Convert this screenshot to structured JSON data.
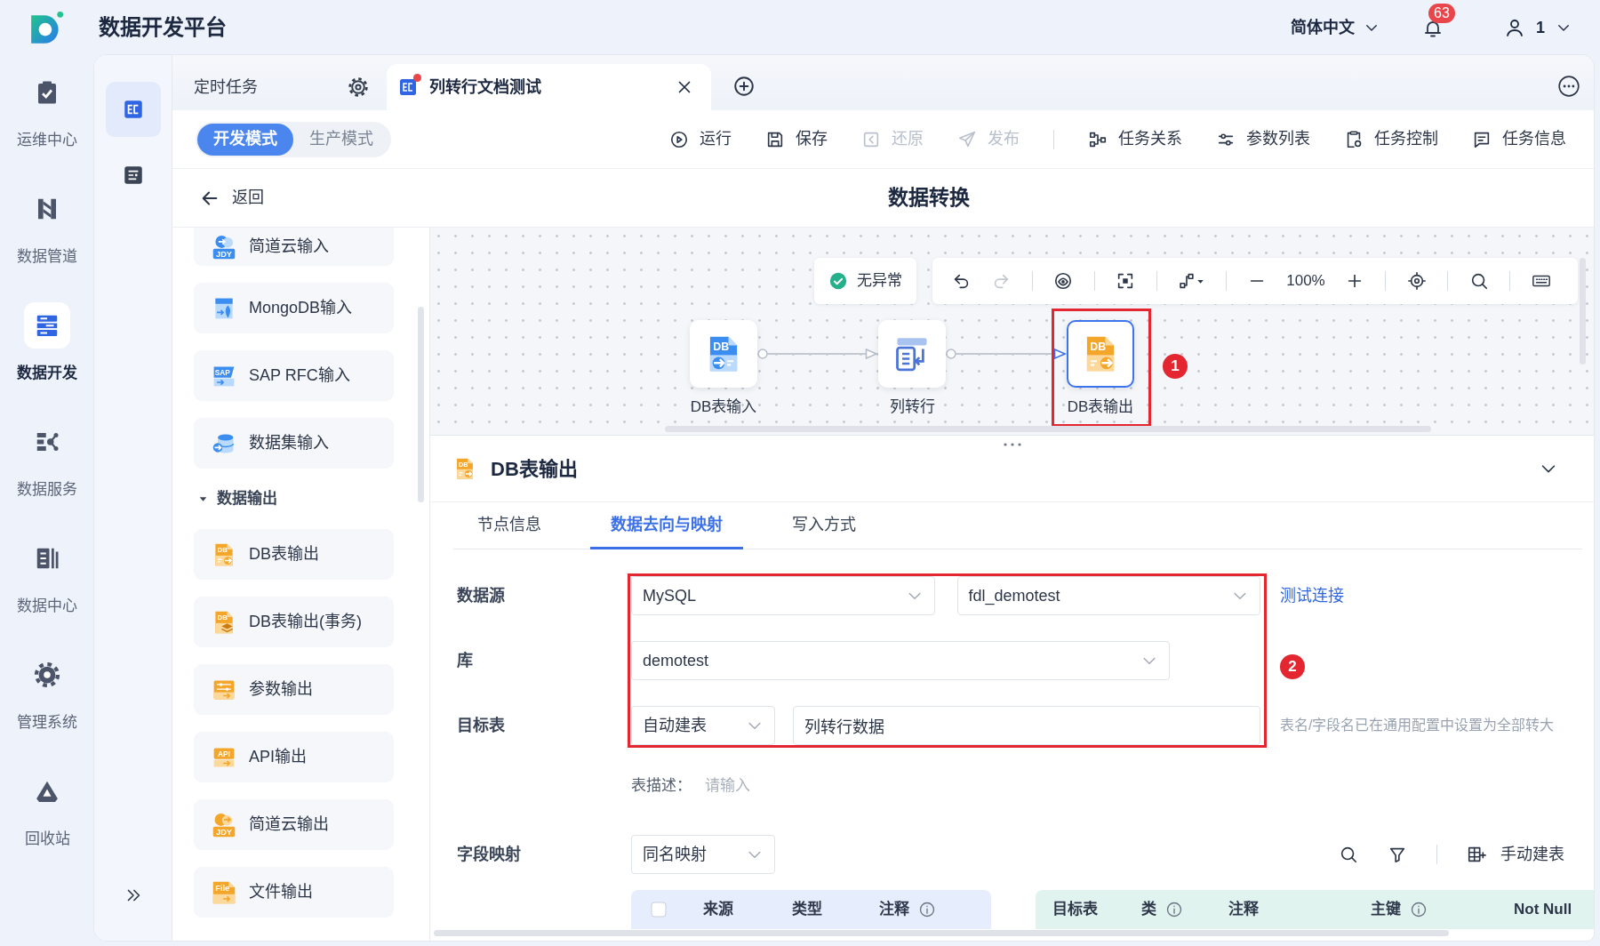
{
  "app": {
    "title": "数据开发平台",
    "language": "简体中文",
    "notifications": "63",
    "user": "1"
  },
  "nav": [
    {
      "label": "运维中心",
      "kind": "ops",
      "selected": false
    },
    {
      "label": "数据管道",
      "kind": "pipeline",
      "selected": false
    },
    {
      "label": "数据开发",
      "kind": "develop",
      "selected": true
    },
    {
      "label": "数据服务",
      "kind": "service",
      "selected": false
    },
    {
      "label": "数据中心",
      "kind": "center",
      "selected": false
    },
    {
      "label": "管理系统",
      "kind": "admin",
      "selected": false
    },
    {
      "label": "回收站",
      "kind": "recycle",
      "selected": false
    }
  ],
  "rail": [
    {
      "kind": "flow",
      "selected": true
    },
    {
      "kind": "list",
      "selected": false
    }
  ],
  "tabs": [
    {
      "label": "定时任务",
      "kind": "folder",
      "selected": false,
      "unsaved": false
    },
    {
      "label": "列转行文档测试",
      "kind": "task",
      "selected": true,
      "unsaved": true
    }
  ],
  "modes": [
    {
      "label": "开发模式",
      "selected": true
    },
    {
      "label": "生产模式",
      "selected": false
    }
  ],
  "action_groups": [
    [
      {
        "label": "运行",
        "kind": "run",
        "disabled": false
      },
      {
        "label": "保存",
        "kind": "save",
        "disabled": false
      },
      {
        "label": "还原",
        "kind": "restore",
        "disabled": true
      },
      {
        "label": "发布",
        "kind": "publish",
        "disabled": true
      }
    ],
    [
      {
        "label": "任务关系",
        "kind": "relation",
        "disabled": false
      },
      {
        "label": "参数列表",
        "kind": "params",
        "disabled": false
      },
      {
        "label": "任务控制",
        "kind": "control",
        "disabled": false
      },
      {
        "label": "任务信息",
        "kind": "info",
        "disabled": false
      }
    ]
  ],
  "back": "返回",
  "page_title": "数据转换",
  "component_groups": [
    {
      "expanded": true,
      "items": [
        {
          "label": "简道云输入",
          "kind": "jdy-input",
          "icon_text": "JDY"
        },
        {
          "label": "MongoDB输入",
          "kind": "mongodb-input"
        },
        {
          "label": "SAP RFC输入",
          "kind": "sap-input",
          "icon_text": "SAP"
        },
        {
          "label": "数据集输入",
          "kind": "dataset-input"
        }
      ]
    },
    {
      "label": "数据输出",
      "expanded": true,
      "items": [
        {
          "label": "DB表输出",
          "kind": "db-output",
          "icon_text": "DB"
        },
        {
          "label": "DB表输出(事务)",
          "kind": "db-output-tx",
          "icon_text": "DB"
        },
        {
          "label": "参数输出",
          "kind": "param-output"
        },
        {
          "label": "API输出",
          "kind": "api-output",
          "icon_text": "API"
        },
        {
          "label": "简道云输出",
          "kind": "jdy-output",
          "icon_text": "JDY"
        },
        {
          "label": "文件输出",
          "kind": "file-output",
          "icon_text": "File"
        }
      ]
    }
  ],
  "canvas": {
    "status": "无异常",
    "tool_groups": [
      [
        {
          "kind": "undo",
          "disabled": false
        },
        {
          "kind": "redo",
          "disabled": true
        }
      ],
      [
        {
          "kind": "preview",
          "disabled": false
        }
      ],
      [
        {
          "kind": "fit",
          "disabled": false
        }
      ],
      [
        {
          "kind": "layout",
          "disabled": false
        }
      ],
      [
        {
          "kind": "zoom-out",
          "disabled": false
        },
        {
          "kind": "zoom-level",
          "label": "100%"
        },
        {
          "kind": "zoom-in",
          "disabled": false
        }
      ],
      [
        {
          "kind": "locate",
          "disabled": false
        }
      ],
      [
        {
          "kind": "search",
          "disabled": false
        }
      ],
      [
        {
          "kind": "keyboard",
          "disabled": false
        }
      ]
    ],
    "nodes": [
      {
        "label": "DB表输入",
        "kind": "db-input",
        "icon_text": "DB",
        "selected": false,
        "highlighted": false
      },
      {
        "label": "列转行",
        "kind": "pivot",
        "selected": false,
        "highlighted": false
      },
      {
        "label": "DB表输出",
        "kind": "db-output",
        "icon_text": "DB",
        "selected": true,
        "highlighted": true,
        "callout": "1"
      }
    ]
  },
  "detail": {
    "title": "DB表输出",
    "kind": "db-output",
    "icon_text": "DB",
    "tabs": [
      {
        "label": "节点信息",
        "selected": false
      },
      {
        "label": "数据去向与映射",
        "selected": true
      },
      {
        "label": "写入方式",
        "selected": false
      }
    ],
    "form": {
      "highlighted": true,
      "rows": [
        {
          "label": "数据源",
          "kind": "source",
          "fields": [
            {
              "kind": "select",
              "value": "MySQL"
            },
            {
              "kind": "select",
              "value": "fdl_demotest"
            }
          ],
          "link": "测试连接"
        },
        {
          "label": "库",
          "kind": "database",
          "fields": [
            {
              "kind": "select",
              "value": "demotest"
            }
          ],
          "callout": "2"
        },
        {
          "label": "目标表",
          "kind": "target",
          "fields": [
            {
              "kind": "select",
              "value": "自动建表"
            },
            {
              "kind": "input",
              "value": "列转行数据"
            }
          ],
          "hint": "表名/字段名已在通用配置中设置为全部转大"
        }
      ],
      "description": {
        "label": "表描述：",
        "placeholder": "请输入"
      },
      "mapping": {
        "label": "字段映射",
        "value": "同名映射",
        "action": "手动建表"
      }
    },
    "mapping_table": {
      "source": {
        "checked": false,
        "columns": [
          {
            "label": "来源",
            "info": false
          },
          {
            "label": "类型",
            "info": false
          },
          {
            "label": "注释",
            "info": true
          }
        ]
      },
      "target": {
        "columns": [
          {
            "label": "目标表",
            "info": false
          },
          {
            "label": "类",
            "info": true
          },
          {
            "label": "注释",
            "info": false
          },
          {
            "label": "主键",
            "info": true
          },
          {
            "label": "Not Null",
            "info": false
          }
        ]
      }
    }
  }
}
